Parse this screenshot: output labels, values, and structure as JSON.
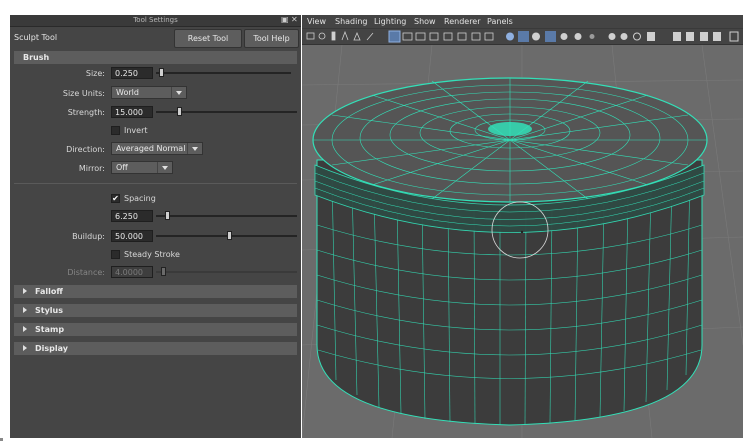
{
  "tool_settings": {
    "window_title": "Tool Settings",
    "tool_name": "Sculpt Tool",
    "reset_label": "Reset Tool",
    "help_label": "Tool Help",
    "float_icon": "float-icon",
    "close_icon": "close-icon"
  },
  "brush": {
    "header": "Brush",
    "size_label": "Size:",
    "size_value": "0.250",
    "size_slider_fraction": 0.02,
    "size_units_label": "Size Units:",
    "size_units_value": "World",
    "strength_label": "Strength:",
    "strength_value": "15.000",
    "strength_slider_fraction": 0.15,
    "invert_label": "Invert",
    "invert_checked": false,
    "direction_label": "Direction:",
    "direction_value": "Averaged Normal",
    "mirror_label": "Mirror:",
    "mirror_value": "Off",
    "spacing_label": "Spacing",
    "spacing_checked": true,
    "spacing_value": "6.250",
    "spacing_slider_fraction": 0.0625,
    "buildup_label": "Buildup:",
    "buildup_value": "50.000",
    "buildup_slider_fraction": 0.5,
    "steady_label": "Steady Stroke",
    "steady_checked": false,
    "distance_label": "Distance:",
    "distance_value": "4.0000"
  },
  "sections": {
    "falloff": "Falloff",
    "stylus": "Stylus",
    "stamp": "Stamp",
    "display": "Display"
  },
  "viewport": {
    "menu": [
      "View",
      "Shading",
      "Lighting",
      "Show",
      "Renderer",
      "Panels"
    ],
    "wire_color": "#33e0b8",
    "background_color": "#6b6b6b"
  }
}
